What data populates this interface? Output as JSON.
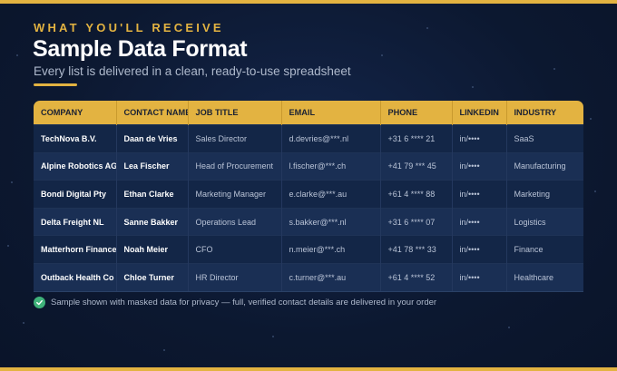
{
  "header": {
    "eyebrow": "WHAT YOU'LL RECEIVE",
    "title": "Sample Data Format",
    "subtitle": "Every list is delivered in a clean, ready-to-use spreadsheet"
  },
  "table": {
    "columns": [
      "COMPANY",
      "CONTACT NAME",
      "JOB TITLE",
      "EMAIL",
      "PHONE",
      "LINKEDIN",
      "INDUSTRY"
    ],
    "rows": [
      [
        "TechNova B.V.",
        "Daan de Vries",
        "Sales Director",
        "d.devries@***.nl",
        "+31 6 **** 21",
        "in/••••",
        "SaaS"
      ],
      [
        "Alpine Robotics AG",
        "Lea Fischer",
        "Head of Procurement",
        "l.fischer@***.ch",
        "+41 79 *** 45",
        "in/••••",
        "Manufacturing"
      ],
      [
        "Bondi Digital Pty",
        "Ethan Clarke",
        "Marketing Manager",
        "e.clarke@***.au",
        "+61 4 **** 88",
        "in/••••",
        "Marketing"
      ],
      [
        "Delta Freight NL",
        "Sanne Bakker",
        "Operations Lead",
        "s.bakker@***.nl",
        "+31 6 **** 07",
        "in/••••",
        "Logistics"
      ],
      [
        "Matterhorn Finance",
        "Noah Meier",
        "CFO",
        "n.meier@***.ch",
        "+41 78 *** 33",
        "in/••••",
        "Finance"
      ],
      [
        "Outback Health Co",
        "Chloe Turner",
        "HR Director",
        "c.turner@***.au",
        "+61 4 **** 52",
        "in/••••",
        "Healthcare"
      ]
    ]
  },
  "note": {
    "icon": "check-circle-icon",
    "text": "Sample shown with masked data for privacy — full, verified contact details are delivered in your order"
  },
  "colors": {
    "accent": "#e3b341",
    "background": "#0d1a33",
    "check": "#3fb27a"
  }
}
